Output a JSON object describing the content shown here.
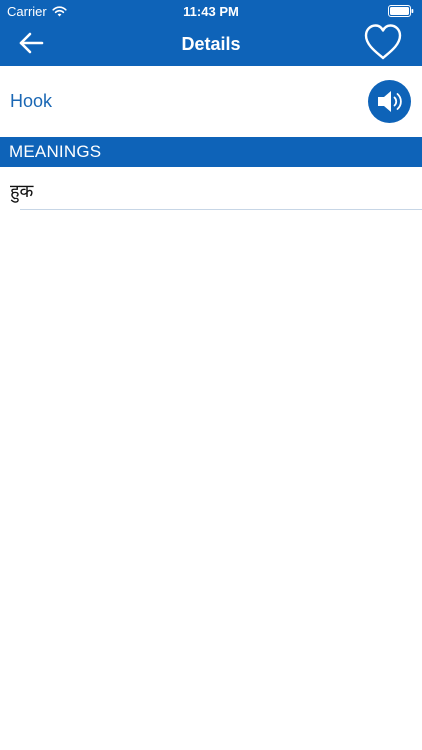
{
  "status_bar": {
    "carrier": "Carrier",
    "time": "11:43 PM"
  },
  "nav": {
    "title": "Details",
    "back_icon": "arrow-left-icon",
    "favorite_icon": "heart-outline-icon"
  },
  "word": {
    "text": "Hook",
    "speaker_icon": "speaker-icon"
  },
  "meanings": {
    "header": "MEANINGS",
    "items": [
      "हुक"
    ]
  },
  "colors": {
    "primary": "#0e63b8",
    "link_text": "#1a67b4",
    "background": "#ffffff",
    "divider": "#c7d6e6"
  }
}
